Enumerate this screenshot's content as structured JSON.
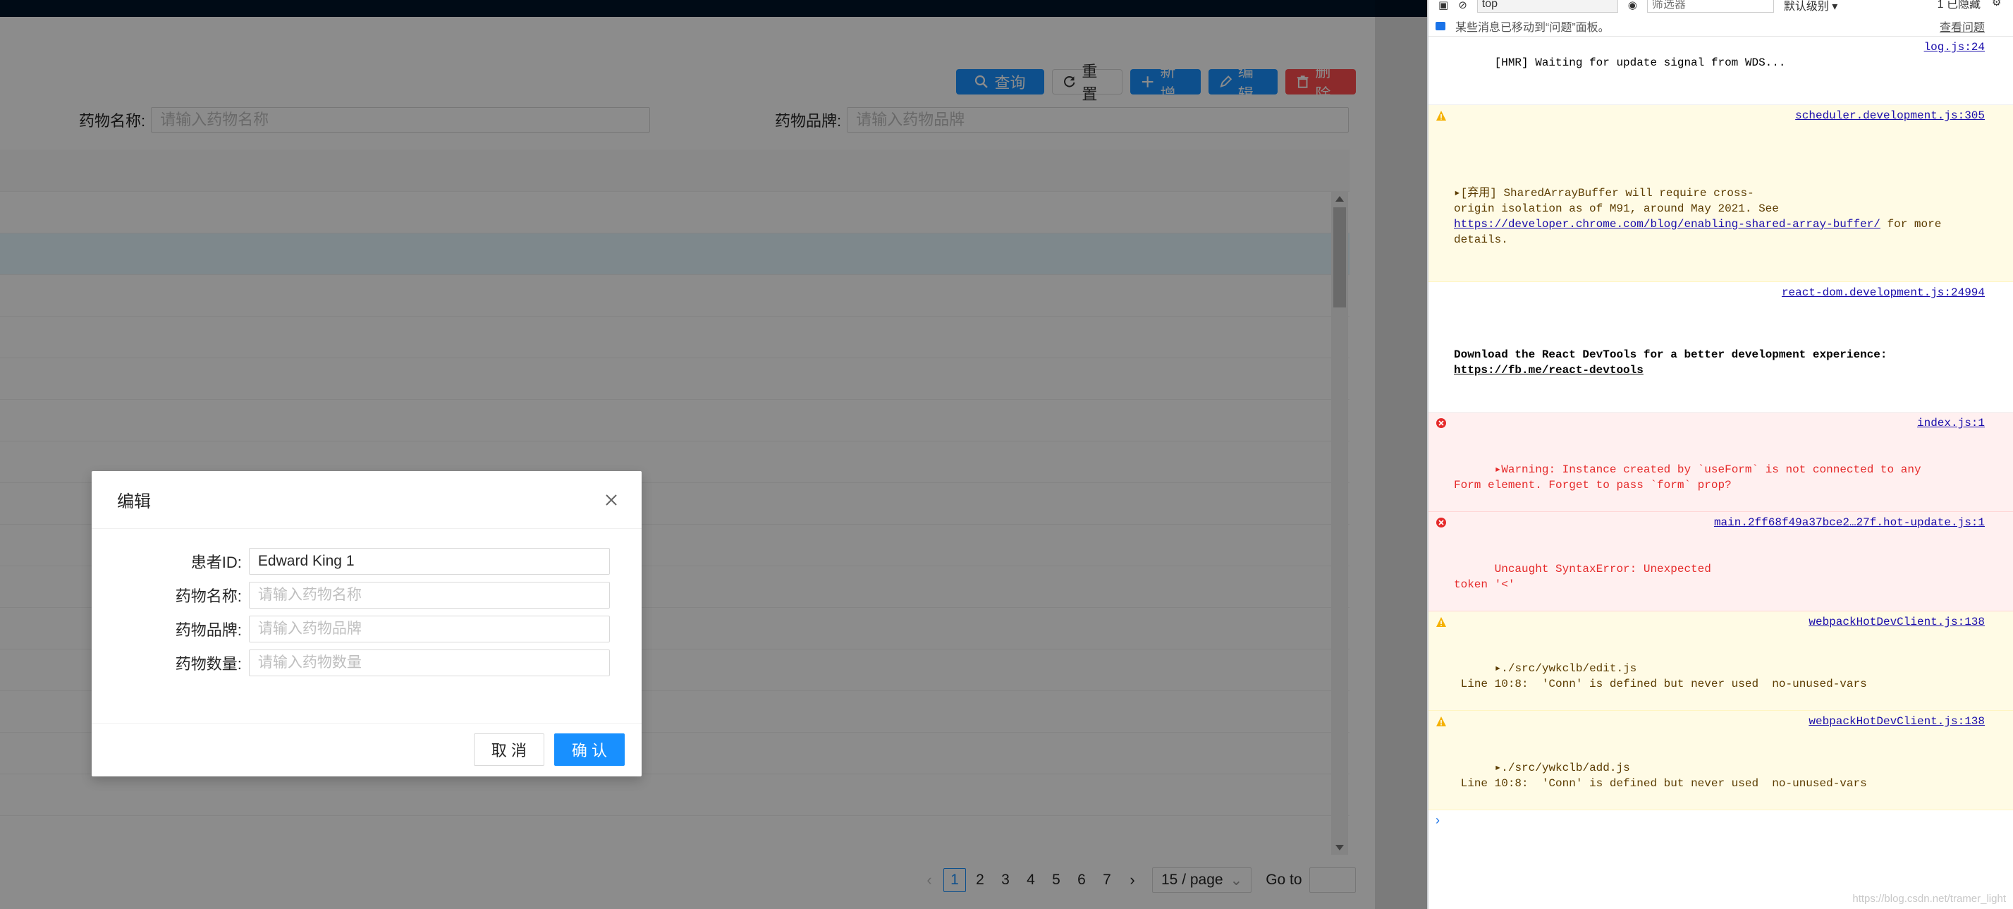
{
  "toolbar": {
    "query_label": "查询",
    "reset_label": "重置",
    "add_label": "新增",
    "edit_label": "编辑",
    "delete_label": "删除"
  },
  "search": {
    "drug_name_label": "药物名称:",
    "drug_name_placeholder": "请输入药物名称",
    "drug_brand_label": "药物品牌:",
    "drug_brand_placeholder": "请输入药物品牌"
  },
  "pagination": {
    "pages": [
      "1",
      "2",
      "3",
      "4",
      "5",
      "6",
      "7"
    ],
    "current": "1",
    "page_size": "15 / page",
    "goto_label": "Go to"
  },
  "modal": {
    "title": "编辑",
    "fields": [
      {
        "label": "患者ID:",
        "value": "Edward King 1",
        "placeholder": ""
      },
      {
        "label": "药物名称:",
        "value": "",
        "placeholder": "请输入药物名称"
      },
      {
        "label": "药物品牌:",
        "value": "",
        "placeholder": "请输入药物品牌"
      },
      {
        "label": "药物数量:",
        "value": "",
        "placeholder": "请输入药物数量"
      }
    ],
    "cancel_label": "取 消",
    "ok_label": "确 认"
  },
  "devtools": {
    "context": "top",
    "filter_placeholder": "筛选器",
    "level": "默认级别 ▾",
    "hidden": "1 已隐藏",
    "info_text": "某些消息已移动到“问题”面板。",
    "info_link": "查看问题",
    "messages": [
      {
        "type": "log",
        "text": "[HMR] Waiting for update signal from WDS...",
        "source": "log.js:24"
      },
      {
        "type": "warn",
        "text": "▸[弃用] SharedArrayBuffer will require cross-\norigin isolation as of M91, around May 2021. See ",
        "link": "https://developer.chrome.com/blog/enabling-shared-array-buffer/",
        "tail": " for more details.",
        "source": "scheduler.development.js:305"
      },
      {
        "type": "log",
        "text": "Download the React DevTools for a better development experience: ",
        "link": "https://fb.me/react-devtools",
        "source": "react-dom.development.js:24994"
      },
      {
        "type": "error",
        "text": "▸Warning: Instance created by `useForm` is not connected to any\nForm element. Forget to pass `form` prop?",
        "source": "index.js:1"
      },
      {
        "type": "error",
        "text": "Uncaught SyntaxError: Unexpected\ntoken '<'",
        "source": "main.2ff68f49a37bce2…27f.hot-update.js:1"
      },
      {
        "type": "warn",
        "text": "▸./src/ywkclb/edit.js\n Line 10:8:  'Conn' is defined but never used  no-unused-vars",
        "source": "webpackHotDevClient.js:138"
      },
      {
        "type": "warn",
        "text": "▸./src/ywkclb/add.js\n Line 10:8:  'Conn' is defined but never used  no-unused-vars",
        "source": "webpackHotDevClient.js:138"
      }
    ],
    "prompt": "›",
    "watermark": "https://blog.csdn.net/tramer_light"
  },
  "colors": {
    "primary": "#1890ff",
    "danger": "#ff4d4f",
    "header_bg": "#001529",
    "warn_bg": "#fffbe5",
    "error_bg": "#fff0f0"
  }
}
